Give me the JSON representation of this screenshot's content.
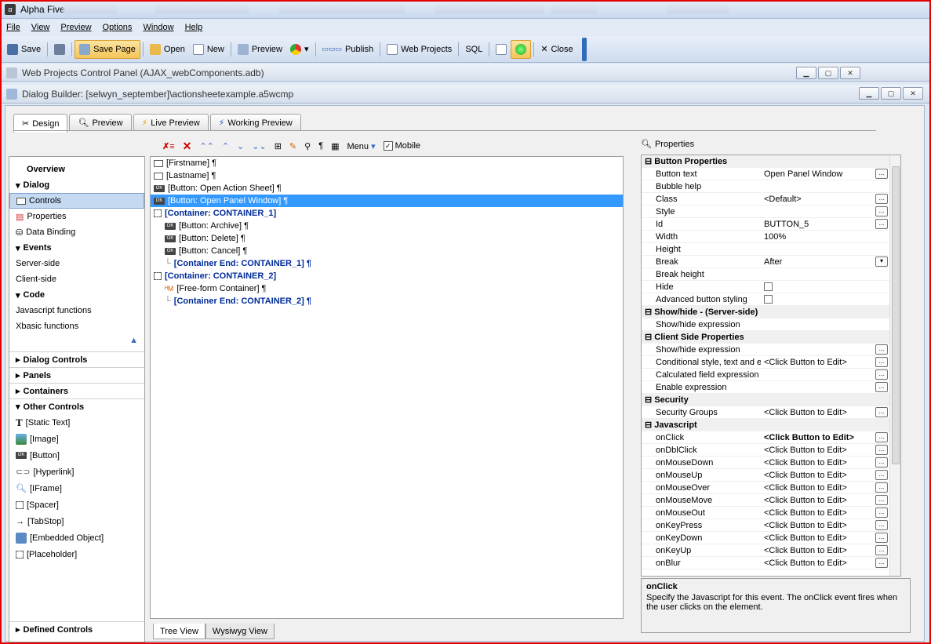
{
  "app": {
    "title": "Alpha Five"
  },
  "menu": [
    "File",
    "View",
    "Preview",
    "Options",
    "Window",
    "Help"
  ],
  "toolbar": {
    "save": "Save",
    "save_page": "Save Page",
    "open": "Open",
    "new": "New",
    "preview": "Preview",
    "publish": "Publish",
    "web_projects": "Web Projects",
    "sql": "SQL",
    "close": "Close"
  },
  "window1": {
    "title": "Web Projects Control Panel (AJAX_webComponents.adb)"
  },
  "window2": {
    "title": "Dialog Builder: [selwyn_september]\\actionsheetexample.a5wcmp"
  },
  "tabs": [
    "Design",
    "Preview",
    "Live Preview",
    "Working Preview"
  ],
  "left": {
    "overview": "Overview",
    "dialog": "Dialog",
    "controls": "Controls",
    "properties": "Properties",
    "data_binding": "Data Binding",
    "events": "Events",
    "server_side": "Server-side",
    "client_side": "Client-side",
    "code": "Code",
    "js_functions": "Javascript functions",
    "xbasic_functions": "Xbasic functions",
    "dialog_controls": "Dialog Controls",
    "panels": "Panels",
    "containers": "Containers",
    "other_controls": "Other Controls",
    "items": [
      "[Static Text]",
      "[Image]",
      "[Button]",
      "[Hyperlink]",
      "[IFrame]",
      "[Spacer]",
      "[TabStop]",
      "[Embedded Object]",
      "[Placeholder]"
    ],
    "defined_controls": "Defined Controls"
  },
  "tree_toolbar": {
    "menu": "Menu",
    "mobile": "Mobile"
  },
  "tree": [
    {
      "t": "[Firstname] ¶",
      "k": "field",
      "i": 0
    },
    {
      "t": "[Lastname] ¶",
      "k": "field",
      "i": 0
    },
    {
      "t": "[Button: Open Action Sheet] ¶",
      "k": "ok",
      "i": 0
    },
    {
      "t": "[Button: Open Panel Window] ¶",
      "k": "ok",
      "i": 0,
      "sel": true
    },
    {
      "t": "[Container: CONTAINER_1]",
      "k": "cont",
      "i": 0
    },
    {
      "t": "[Button: Archive] ¶",
      "k": "ok",
      "i": 1
    },
    {
      "t": "[Button: Delete] ¶",
      "k": "ok",
      "i": 1
    },
    {
      "t": "[Button: Cancel] ¶",
      "k": "ok",
      "i": 1
    },
    {
      "t": "[Container End: CONTAINER_1] ¶",
      "k": "contend",
      "i": 1
    },
    {
      "t": "[Container: CONTAINER_2]",
      "k": "cont",
      "i": 0
    },
    {
      "t": "[Free-form Container] ¶",
      "k": "ff",
      "i": 1
    },
    {
      "t": "[Container End: CONTAINER_2] ¶",
      "k": "contend",
      "i": 1
    }
  ],
  "bottom_tabs": [
    "Tree View",
    "Wysiwyg View"
  ],
  "props_title": "Properties",
  "props": [
    {
      "c": "Button Properties"
    },
    {
      "k": "Button text",
      "v": "Open Panel Window",
      "b": "..."
    },
    {
      "k": "Bubble help",
      "v": ""
    },
    {
      "k": "Class",
      "v": "<Default>",
      "b": "..."
    },
    {
      "k": "Style",
      "v": "",
      "b": "..."
    },
    {
      "k": "Id",
      "v": "BUTTON_5",
      "b": "..."
    },
    {
      "k": "Width",
      "v": "100%"
    },
    {
      "k": "Height",
      "v": ""
    },
    {
      "k": "Break",
      "v": "After",
      "b": "▾"
    },
    {
      "k": "Break height",
      "v": ""
    },
    {
      "k": "Hide",
      "v": "",
      "cb": true
    },
    {
      "k": "Advanced button styling",
      "v": "",
      "cb": true
    },
    {
      "c": "Show/hide - (Server-side)"
    },
    {
      "k": "Show/hide expression",
      "v": ""
    },
    {
      "c": "Client Side Properties"
    },
    {
      "k": "Show/hide expression",
      "v": "",
      "b": "..."
    },
    {
      "k": "Conditional style, text and events",
      "v": "<Click Button to Edit>",
      "b": "..."
    },
    {
      "k": "Calculated field expression",
      "v": "",
      "b": "..."
    },
    {
      "k": "Enable expression",
      "v": "",
      "b": "..."
    },
    {
      "c": "Security"
    },
    {
      "k": "Security Groups",
      "v": "<Click Button to Edit>",
      "b": "..."
    },
    {
      "c": "Javascript"
    },
    {
      "k": "onClick",
      "v": "<Click Button to Edit>",
      "b": "...",
      "bold": true
    },
    {
      "k": "onDblClick",
      "v": "<Click Button to Edit>",
      "b": "..."
    },
    {
      "k": "onMouseDown",
      "v": "<Click Button to Edit>",
      "b": "..."
    },
    {
      "k": "onMouseUp",
      "v": "<Click Button to Edit>",
      "b": "..."
    },
    {
      "k": "onMouseOver",
      "v": "<Click Button to Edit>",
      "b": "..."
    },
    {
      "k": "onMouseMove",
      "v": "<Click Button to Edit>",
      "b": "..."
    },
    {
      "k": "onMouseOut",
      "v": "<Click Button to Edit>",
      "b": "..."
    },
    {
      "k": "onKeyPress",
      "v": "<Click Button to Edit>",
      "b": "..."
    },
    {
      "k": "onKeyDown",
      "v": "<Click Button to Edit>",
      "b": "..."
    },
    {
      "k": "onKeyUp",
      "v": "<Click Button to Edit>",
      "b": "..."
    },
    {
      "k": "onBlur",
      "v": "<Click Button to Edit>",
      "b": "..."
    }
  ],
  "desc": {
    "title": "onClick",
    "text": "Specify the Javascript for this event.  The onClick event fires when the user clicks on the element."
  }
}
